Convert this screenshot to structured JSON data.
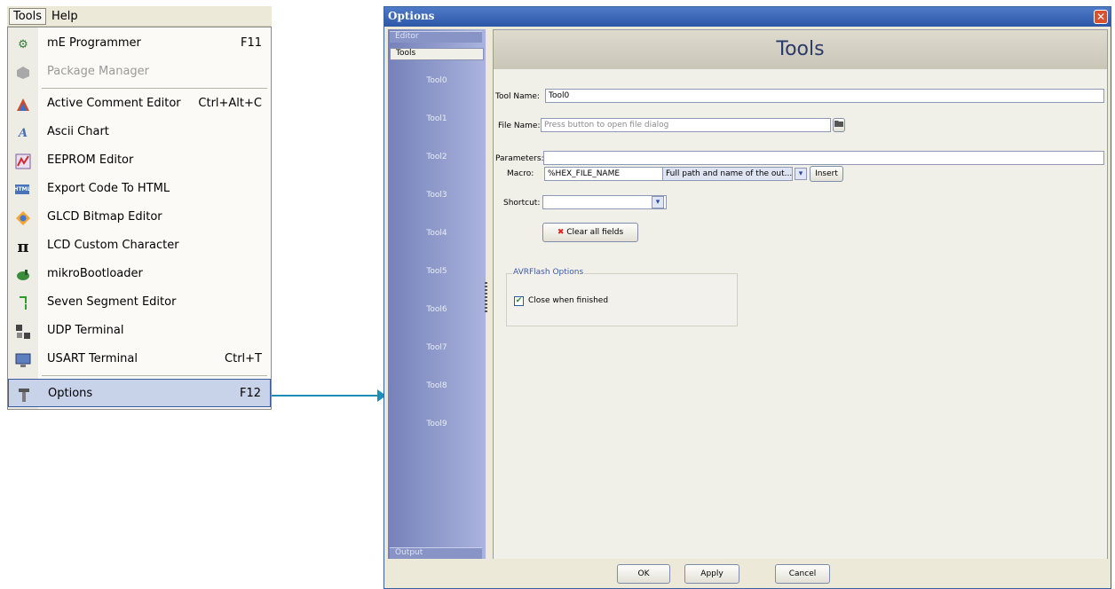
{
  "menubar": {
    "tools": "Tools",
    "help": "Help"
  },
  "menu": {
    "items": [
      {
        "label": "mE Programmer",
        "shortcut": "F11",
        "icon": "programmer-icon"
      },
      {
        "label": "Package Manager",
        "shortcut": "",
        "icon": "package-icon",
        "disabled": true
      },
      {
        "label": "Active Comment Editor",
        "shortcut": "Ctrl+Alt+C",
        "icon": "comment-editor-icon"
      },
      {
        "label": "Ascii Chart",
        "shortcut": "",
        "icon": "ascii-icon"
      },
      {
        "label": "EEPROM Editor",
        "shortcut": "",
        "icon": "eeprom-icon"
      },
      {
        "label": "Export Code To HTML",
        "shortcut": "",
        "icon": "html-icon"
      },
      {
        "label": "GLCD Bitmap Editor",
        "shortcut": "",
        "icon": "glcd-icon"
      },
      {
        "label": "LCD Custom Character",
        "shortcut": "",
        "icon": "lcd-icon"
      },
      {
        "label": "mikroBootloader",
        "shortcut": "",
        "icon": "bootloader-icon"
      },
      {
        "label": "Seven Segment Editor",
        "shortcut": "",
        "icon": "seven-segment-icon"
      },
      {
        "label": "UDP Terminal",
        "shortcut": "",
        "icon": "udp-terminal-icon"
      },
      {
        "label": "USART Terminal",
        "shortcut": "Ctrl+T",
        "icon": "usart-terminal-icon"
      },
      {
        "label": "Options",
        "shortcut": "F12",
        "icon": "options-icon",
        "selected": true
      }
    ],
    "icon_glyphs": {
      "ascii": "A",
      "html": "HTML",
      "lcd": "π"
    }
  },
  "dialog": {
    "title": "Options",
    "close": "✕",
    "side_tabs": {
      "editor": "Editor",
      "tools": "Tools",
      "output": "Output"
    },
    "tool_list": [
      "Tool0",
      "Tool1",
      "Tool2",
      "Tool3",
      "Tool4",
      "Tool5",
      "Tool6",
      "Tool7",
      "Tool8",
      "Tool9"
    ],
    "header": "Tools",
    "form": {
      "tool_name_label": "Tool Name:",
      "tool_name_value": "Tool0",
      "file_name_label": "File Name:",
      "file_name_placeholder": "Press button to open file dialog",
      "parameters_label": "Parameters:",
      "parameters_value": "",
      "macro_label": "Macro:",
      "macro_value": "%HEX_FILE_NAME",
      "macro_desc": "Full path and name of the out...",
      "insert_button": "Insert",
      "shortcut_label": "Shortcut:",
      "shortcut_value": "",
      "clear_button": "Clear all fields"
    },
    "avrflash": {
      "legend": "AVRFlash Options",
      "close_when_finished": "Close when finished",
      "checked": true
    },
    "buttons": {
      "ok": "OK",
      "apply": "Apply",
      "cancel": "Cancel"
    }
  },
  "colors": {
    "arrow": "#1d8fb7",
    "sidebar": "#8c97cb",
    "title_bar": "#2c57a8",
    "selected_item": "#c8d2e8"
  }
}
